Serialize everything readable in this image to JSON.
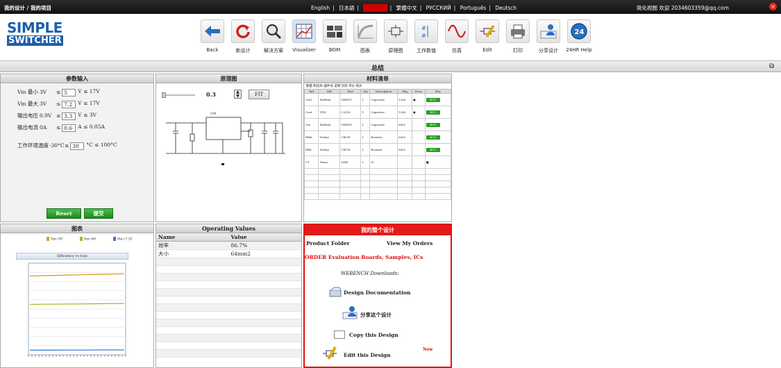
{
  "topbar": {
    "crumb": "我的设计 / 我的项目",
    "languages": [
      "English",
      "日本語",
      "■■■■",
      "繁體中文",
      "РУССКИЙ",
      "Português",
      "Deutsch"
    ],
    "language_separators": [
      "|",
      "|",
      "|",
      "|",
      "|",
      "|"
    ],
    "user_text": "简化视图  欢迎  2034603359@qq.com"
  },
  "logo": {
    "line1": "SIMPLE",
    "line2": "SWITCHER"
  },
  "toolbar": [
    {
      "label": "Back"
    },
    {
      "label": "新设计"
    },
    {
      "label": "解决方案"
    },
    {
      "label": "Visualizer"
    },
    {
      "label": "BOM"
    },
    {
      "label": "图表"
    },
    {
      "label": "原理图"
    },
    {
      "label": "工作数值"
    },
    {
      "label": "仿真"
    },
    {
      "label": "Edit"
    },
    {
      "label": "打印"
    },
    {
      "label": "分享设计"
    },
    {
      "label": "24HR Help"
    }
  ],
  "section_title": "总结",
  "params": {
    "title": "参数输入",
    "rows": [
      {
        "label": "Vin 最小",
        "range_val": "3V",
        "value": "5",
        "unit": "V ≤ 17V"
      },
      {
        "label": "Vin 最大",
        "range_val": "3V",
        "value": "7.2",
        "unit": "V ≤ 17V"
      },
      {
        "label": "输出电压",
        "range_val": "0.9V",
        "value": "3.3",
        "unit": "V ≤ 3V"
      },
      {
        "label": "输出电流",
        "range_val": "0A",
        "value": "0.6",
        "unit": "A ≤ 0.05A"
      },
      {
        "label": "工作环境温度",
        "range_val": "-30°C",
        "value": "30",
        "unit": "°C ≤ 100°C"
      }
    ],
    "reset_label": "Reset",
    "submit_label": "提交"
  },
  "schematic": {
    "title": "原理图",
    "zoom_value": "0.3",
    "fit_label": "FIT"
  },
  "bom": {
    "title": "材料清单",
    "subtitle": "数量   制造商   器件号   说明   封装   单价   购买",
    "headers": [
      "Ref",
      "Mfr",
      "Part",
      "Qty",
      "Description",
      "Pkg",
      "Price",
      "Buy"
    ],
    "rows": [
      [
        "Cin1",
        "MuRata",
        "GRM31",
        "1",
        "Capacitor",
        "1206",
        "●",
        "BUY"
      ],
      [
        "Cout",
        "TDK",
        "C3216",
        "1",
        "Capacitor",
        "1206",
        "●",
        "BUY"
      ],
      [
        "Css",
        "MuRata",
        "GRM18",
        "1",
        "Capacitor",
        "0603",
        "-",
        "BUY"
      ],
      [
        "Rfbb",
        "Vishay",
        "CRCW",
        "1",
        "Resistor",
        "0603",
        "-",
        "BUY"
      ],
      [
        "Rfbt",
        "Vishay",
        "CRCW",
        "1",
        "Resistor",
        "0603",
        "-",
        "BUY"
      ],
      [
        "U1",
        "Texas",
        "LMR",
        "1",
        "IC",
        "",
        "",
        "■"
      ]
    ],
    "buy_label": "BUY"
  },
  "charts": {
    "title": "图表",
    "legend": [
      "Vin=5V",
      "Vin=6V",
      "Vin=7.2V"
    ],
    "legend_colors": [
      "#e0a020",
      "#a0c020",
      "#3a7fd0"
    ],
    "chart_title": "Efficiency vs Iout",
    "chart_data": {
      "type": "line",
      "title": "Efficiency vs Iout",
      "ylim": [
        0,
        100
      ],
      "series": [
        {
          "name": "Vin=5V",
          "values": [
            86,
            86.5,
            87,
            87.5,
            88,
            88.3
          ]
        },
        {
          "name": "Vin=6V",
          "values": [
            55,
            55.2,
            55.4,
            55.6,
            55.8,
            56
          ]
        },
        {
          "name": "Vin=7.2V",
          "values": [
            5,
            5.1,
            5.2,
            5.2,
            5.3,
            5.3
          ]
        }
      ]
    }
  },
  "operating": {
    "title": "Operating Values",
    "col_name": "Name",
    "col_value": "Value",
    "rows": [
      {
        "name": "效率",
        "value": "86.7%"
      },
      {
        "name": "大小",
        "value": "64mm2"
      }
    ],
    "empty_rows": 13
  },
  "my_design": {
    "title": "我的整个设计",
    "product_folder": "Product Folder",
    "view_orders": "View My Orders",
    "order_line": "ORDER Evaluation Boards, Samples, ICs",
    "downloads": "WEBENCH Downloads:",
    "design_doc": "Design Documentation",
    "share": "分享这个设计",
    "copy": "Copy this Design",
    "edit": "Edit this Design",
    "new_badge": "New"
  }
}
